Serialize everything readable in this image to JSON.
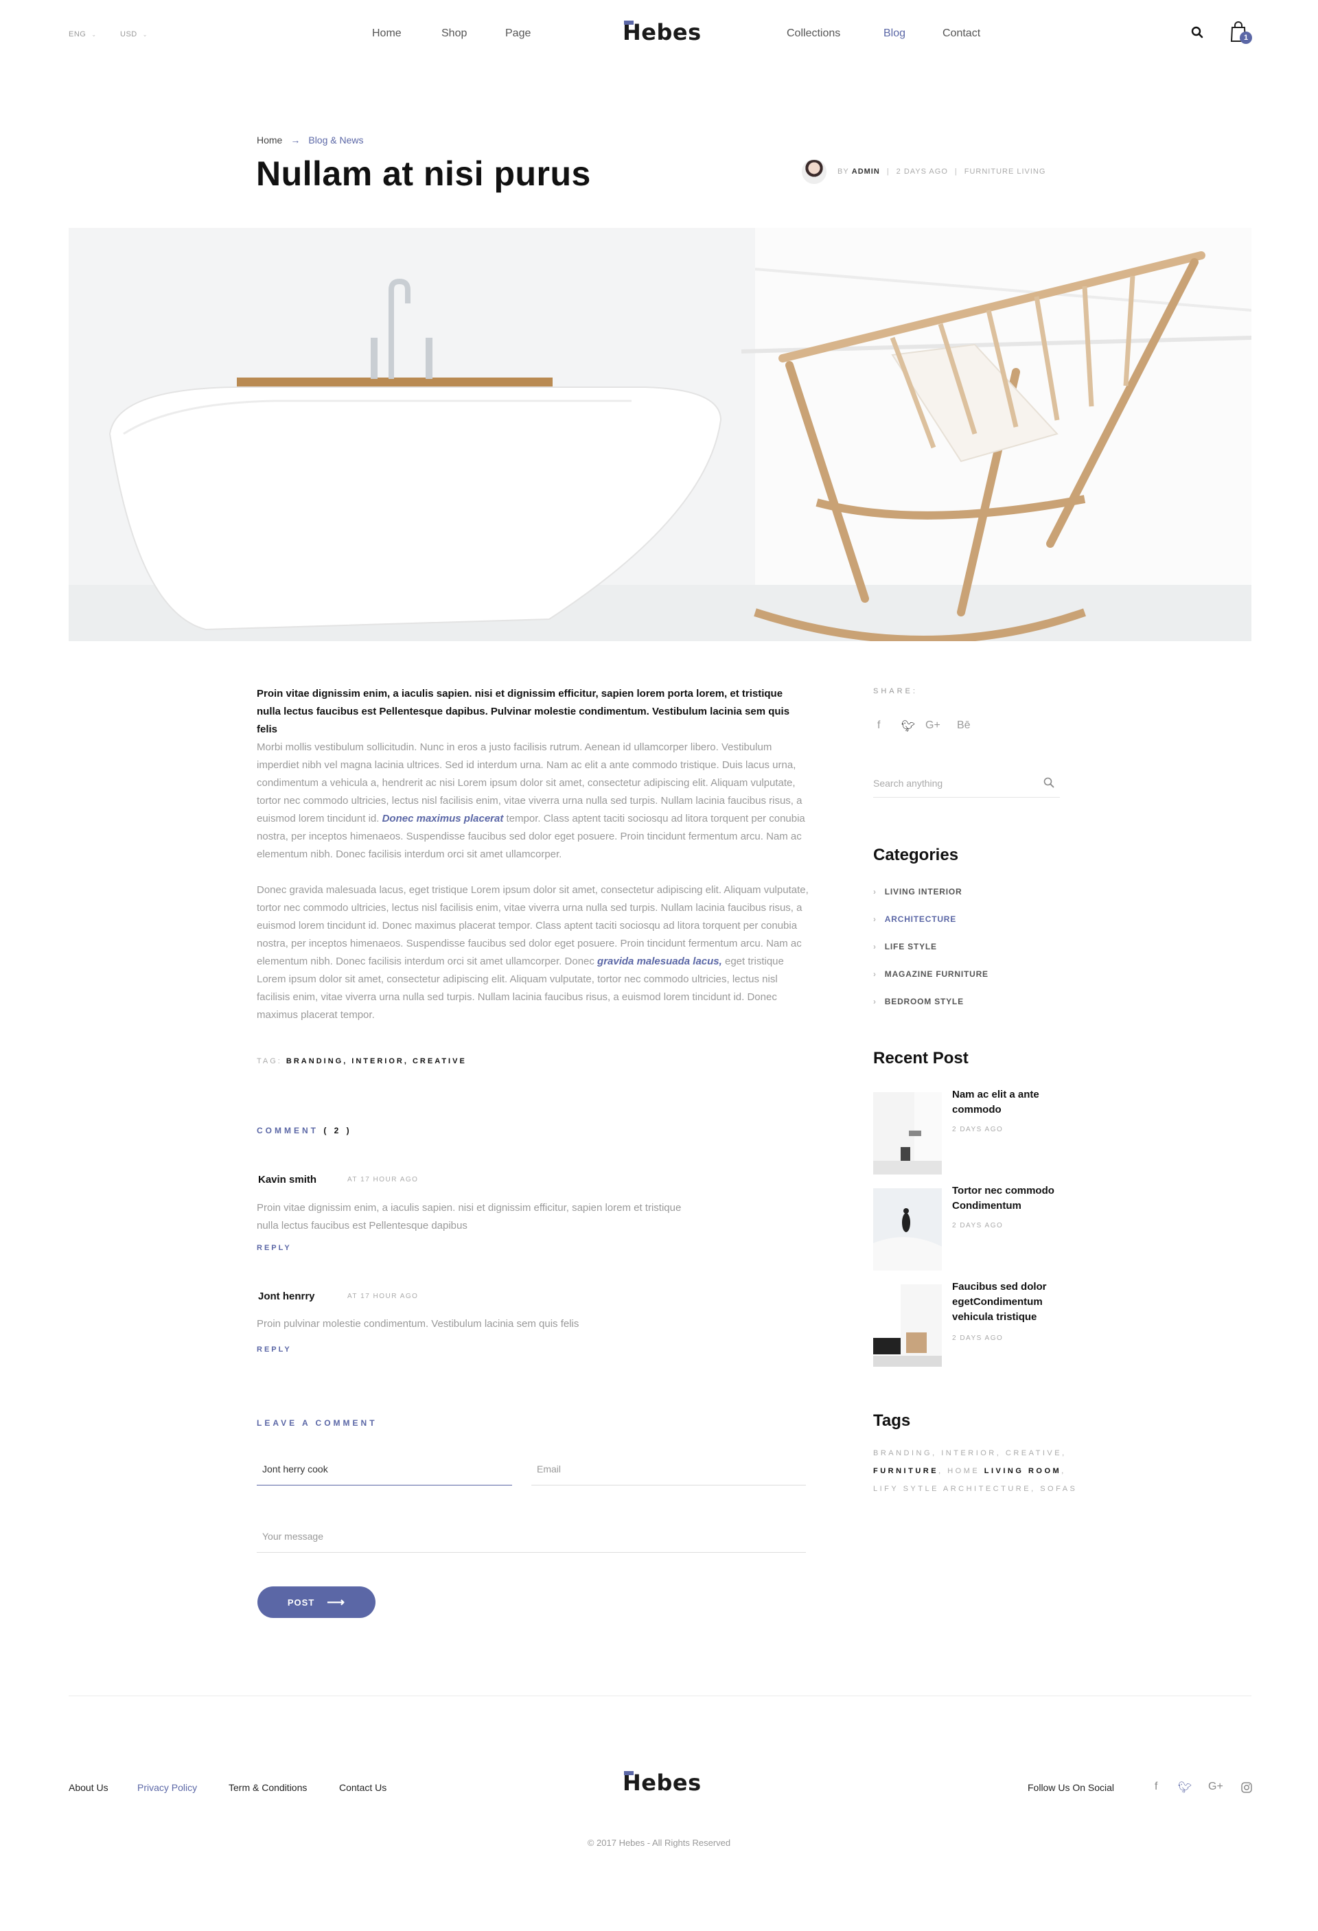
{
  "header": {
    "language": "ENG",
    "currency": "USD",
    "nav_left": [
      "Home",
      "Shop",
      "Page"
    ],
    "nav_right": [
      "Collections",
      "Blog",
      "Contact"
    ],
    "logo": "Hebes",
    "cart_count": "1"
  },
  "breadcrumb": {
    "home": "Home",
    "current": "Blog & News"
  },
  "post": {
    "title": "Nullam at nisi purus",
    "author_prefix": "BY",
    "author": "ADMIN",
    "date": "2 DAYS AGO",
    "category": "FURNITURE LIVING",
    "lead": "Proin vitae dignissim enim, a iaculis sapien. nisi et dignissim efficitur, sapien lorem porta lorem, et tristique nulla lectus faucibus est Pellentesque dapibus. Pulvinar molestie condimentum. Vestibulum lacinia sem quis felis",
    "para1_a": "Morbi mollis vestibulum sollicitudin. Nunc in eros a justo facilisis rutrum. Aenean id ullamcorper libero. Vestibulum imperdiet nibh vel magna lacinia ultrices. Sed id interdum urna. Nam ac elit a ante commodo tristique. Duis lacus urna, condimentum a vehicula a, hendrerit ac nisi Lorem ipsum dolor sit amet, consectetur adipiscing elit. Aliquam vulputate, tortor nec commodo ultricies, lectus nisl facilisis enim, vitae viverra urna nulla sed turpis. Nullam lacinia faucibus risus, a euismod lorem tincidunt id.",
    "para1_link": "Donec maximus placerat",
    "para1_b": "tempor. Class aptent taciti sociosqu ad litora torquent per conubia nostra, per inceptos himenaeos. Suspendisse faucibus sed dolor eget posuere. Proin tincidunt fermentum arcu. Nam ac elementum nibh. Donec facilisis interdum orci sit amet ullamcorper.",
    "para2_a": "Donec gravida malesuada lacus, eget tristique Lorem ipsum dolor sit amet, consectetur adipiscing elit. Aliquam vulputate, tortor nec commodo ultricies, lectus nisl facilisis enim, vitae viverra urna nulla sed turpis. Nullam lacinia faucibus risus, a euismod lorem tincidunt id. Donec maximus placerat tempor. Class aptent taciti sociosqu ad litora torquent per conubia nostra, per inceptos himenaeos. Suspendisse faucibus sed dolor eget posuere. Proin tincidunt fermentum arcu. Nam ac elementum nibh. Donec facilisis interdum orci sit amet ullamcorper. Donec",
    "para2_link": "gravida malesuada lacus,",
    "para2_b": "eget tristique Lorem ipsum dolor sit amet, consectetur adipiscing elit. Aliquam vulputate, tortor nec commodo ultricies, lectus nisl facilisis enim, vitae viverra urna nulla sed turpis. Nullam lacinia faucibus risus, a euismod lorem tincidunt id. Donec maximus placerat tempor.",
    "tag_label": "TAG:",
    "tags": "BRANDING, INTERIOR, CREATIVE"
  },
  "comments": {
    "heading": "COMMENT",
    "count": "( 2 )",
    "items": [
      {
        "name": "Kavin smith",
        "time": "AT 17 HOUR AGO",
        "text": "Proin vitae dignissim enim, a iaculis sapien. nisi et dignissim efficitur, sapien lorem et tristique nulla lectus faucibus est Pellentesque dapibus",
        "reply": "REPLY"
      },
      {
        "name": "Jont henrry",
        "time": "AT 17 HOUR AGO",
        "text": "Proin pulvinar molestie condimentum. Vestibulum lacinia sem quis felis",
        "reply": "REPLY"
      }
    ]
  },
  "form": {
    "heading": "LEAVE A COMMENT",
    "name_value": "Jont herry cook",
    "email_placeholder": "Email",
    "message_placeholder": "Your message",
    "post_label": "POST"
  },
  "sidebar": {
    "share_label": "SHARE:",
    "share_icons": [
      "f",
      "twitter",
      "G+",
      "Bē"
    ],
    "search_placeholder": "Search anything",
    "categories_title": "Categories",
    "categories": [
      "LIVING INTERIOR",
      "ARCHITECTURE",
      "LIFE STYLE",
      "MAGAZINE FURNITURE",
      "BEDROOM STYLE"
    ],
    "recent_title": "Recent Post",
    "recent": [
      {
        "title": "Nam ac elit a ante commodo",
        "date": "2 DAYS AGO"
      },
      {
        "title": "Tortor nec commodo Condimentum",
        "date": "2 DAYS AGO"
      },
      {
        "title": "Faucibus sed dolor egetCondimentum vehicula tristique",
        "date": "2 DAYS AGO"
      }
    ],
    "tags_title": "Tags",
    "tags": [
      {
        "text": "BRANDING",
        "bold": false
      },
      {
        "text": "INTERIOR",
        "bold": false
      },
      {
        "text": "CREATIVE",
        "bold": false
      },
      {
        "text": "FURNITURE",
        "bold": true
      },
      {
        "text": "HOME",
        "bold": false
      },
      {
        "text": "LIVING ROOM",
        "bold": true
      },
      {
        "text": "LIFY SYTLE",
        "bold": false
      },
      {
        "text": "ARCHITECTURE",
        "bold": false
      },
      {
        "text": "SOFAS",
        "bold": false
      }
    ]
  },
  "footer": {
    "links": [
      "About Us",
      "Privacy Policy",
      "Term & Conditions",
      "Contact Us"
    ],
    "logo": "Hebes",
    "follow": "Follow Us On Social",
    "social_icons": [
      "f",
      "twitter",
      "G+",
      "instagram"
    ],
    "copyright": "© 2017 Hebes - All Rights Reserved"
  },
  "colors": {
    "accent": "#5b67a6",
    "text": "#222222",
    "muted": "#999999"
  }
}
